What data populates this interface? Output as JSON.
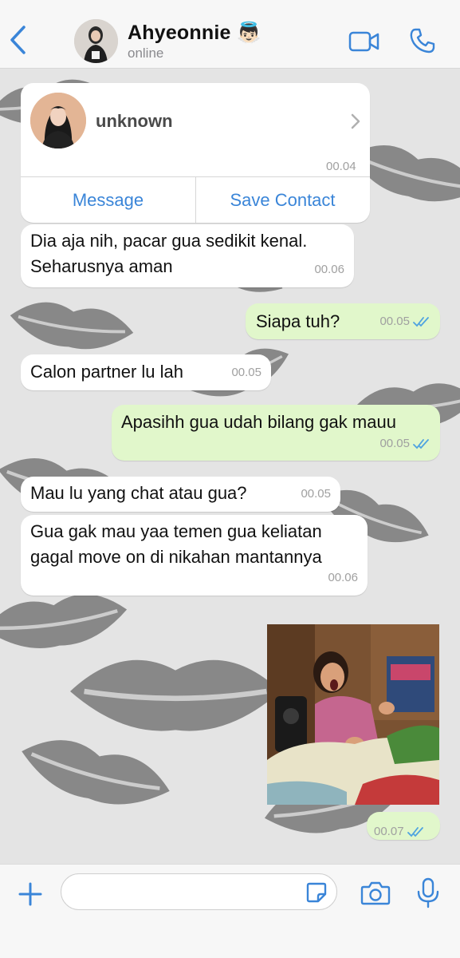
{
  "header": {
    "contact_name": "Ahyeonnie 👼🏻",
    "status": "online"
  },
  "contact_card": {
    "name": "unknown",
    "time": "00.04",
    "message_button": "Message",
    "save_contact_button": "Save Contact"
  },
  "messages": [
    {
      "direction": "incoming",
      "text": "Dia aja nih, pacar gua sedikit kenal. Seharusnya aman",
      "time": "00.06"
    },
    {
      "direction": "outgoing",
      "text": "Siapa tuh?",
      "time": "00.05",
      "status": "read"
    },
    {
      "direction": "incoming",
      "text": "Calon partner lu lah",
      "time": "00.05"
    },
    {
      "direction": "outgoing",
      "text": "Apasihh gua udah bilang gak mauu",
      "time": "00.05",
      "status": "read"
    },
    {
      "direction": "incoming",
      "text": "Mau lu yang chat atau gua?",
      "time": "00.05"
    },
    {
      "direction": "incoming",
      "text": "Gua gak mau yaa temen gua keliatan gagal move on di nikahan mantannya",
      "time": "00.06"
    },
    {
      "direction": "outgoing",
      "type": "image",
      "time": "00.07",
      "status": "read"
    }
  ],
  "input": {
    "placeholder": ""
  },
  "icons": {
    "back": "chevron-left-icon",
    "video": "video-call-icon",
    "call": "phone-icon",
    "add": "plus-icon",
    "sticker": "sticker-icon",
    "camera": "camera-icon",
    "mic": "microphone-icon",
    "read": "double-check-icon"
  },
  "colors": {
    "accent": "#3a85d8",
    "outgoing_bubble": "#e1f7cb",
    "incoming_bubble": "#ffffff",
    "read_tick": "#4fa3e0"
  }
}
